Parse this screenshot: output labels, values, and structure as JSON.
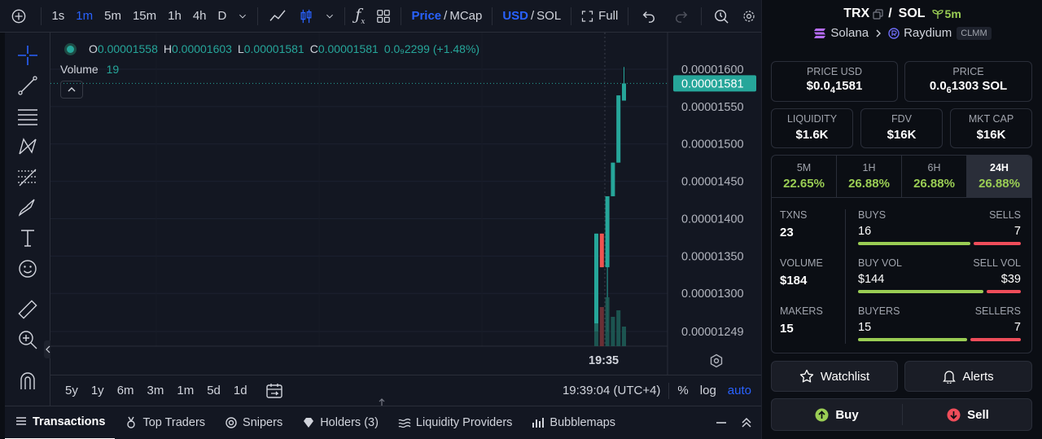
{
  "toolbar": {
    "intervals": [
      "1s",
      "1m",
      "5m",
      "15m",
      "1h",
      "4h",
      "D"
    ],
    "active_interval": "1m",
    "price_label": "Price",
    "mcap_label": "MCap",
    "usd_label": "USD",
    "sol_label": "SOL",
    "full_label": "Full",
    "accent": "#2962ff"
  },
  "legend": {
    "o_label": "O",
    "o_value": "0.00001558",
    "h_label": "H",
    "h_value": "0.00001603",
    "l_label": "L",
    "l_value": "0.00001581",
    "c_label": "C",
    "c_value": "0.00001581",
    "change": "0.0₉2299 (+1.48%)",
    "volume_label": "Volume",
    "volume_value": "19"
  },
  "chart_data": {
    "type": "candlestick",
    "y_ticks": [
      "0.00001600",
      "0.00001550",
      "0.00001500",
      "0.00001450",
      "0.00001400",
      "0.00001350",
      "0.00001300",
      "0.00001249"
    ],
    "ylim": [
      1.249e-05,
      1.6e-05
    ],
    "current_price": "0.00001581",
    "x_tick": "19:35",
    "candles": [
      {
        "o": 1.38e-05,
        "h": 1.38e-05,
        "l": 1.249e-05,
        "c": 1.249e-05,
        "dir": "up"
      },
      {
        "o": 1.335e-05,
        "h": 1.38e-05,
        "l": 1.335e-05,
        "c": 1.38e-05,
        "dir": "down"
      },
      {
        "o": 1.335e-05,
        "h": 1.43e-05,
        "l": 1.249e-05,
        "c": 1.43e-05,
        "dir": "up"
      },
      {
        "o": 1.43e-05,
        "h": 1.475e-05,
        "l": 1.43e-05,
        "c": 1.475e-05,
        "dir": "up"
      },
      {
        "o": 1.475e-05,
        "h": 1.565e-05,
        "l": 1.475e-05,
        "c": 1.565e-05,
        "dir": "up"
      },
      {
        "o": 1.558e-05,
        "h": 1.603e-05,
        "l": 1.558e-05,
        "c": 1.581e-05,
        "dir": "up"
      }
    ],
    "up_color": "#26a69a",
    "down_color": "#ef5350"
  },
  "timebar": {
    "ranges": [
      "5y",
      "1y",
      "6m",
      "3m",
      "1m",
      "5d",
      "1d"
    ],
    "clock": "19:39:04 (UTC+4)",
    "percent_label": "%",
    "log_label": "log",
    "auto_label": "auto"
  },
  "tabs": [
    {
      "label": "Transactions",
      "icon": "list-icon"
    },
    {
      "label": "Top Traders",
      "icon": "medal-icon"
    },
    {
      "label": "Snipers",
      "icon": "target-icon"
    },
    {
      "label": "Holders (3)",
      "icon": "diamond-icon"
    },
    {
      "label": "Liquidity Providers",
      "icon": "water-icon"
    },
    {
      "label": "Bubblemaps",
      "icon": "bubble-icon"
    }
  ],
  "token": {
    "symbol": "TRX",
    "quote": "SOL",
    "age": "5m",
    "chain": "Solana",
    "dex": "Raydium",
    "dex_tag": "CLMM"
  },
  "stats": {
    "price_usd_label": "PRICE USD",
    "price_usd_prefix": "$0.0",
    "price_usd_sub": "4",
    "price_usd_rest": "1581",
    "price_label": "PRICE",
    "price_prefix": "0.0",
    "price_sub": "6",
    "price_rest": "1303 SOL",
    "liquidity_label": "LIQUIDITY",
    "liquidity": "$1.6K",
    "fdv_label": "FDV",
    "fdv": "$16K",
    "mktcap_label": "MKT CAP",
    "mktcap": "$16K"
  },
  "timeframes": [
    {
      "label": "5M",
      "value": "22.65%"
    },
    {
      "label": "1H",
      "value": "26.88%"
    },
    {
      "label": "6H",
      "value": "26.88%"
    },
    {
      "label": "24H",
      "value": "26.88%"
    }
  ],
  "activity": {
    "txns_label": "TXNS",
    "txns": "23",
    "buys_label": "BUYS",
    "buys": "16",
    "sells_label": "SELLS",
    "sells": "7",
    "buys_fraction": 0.7,
    "volume_label": "VOLUME",
    "volume": "$184",
    "buy_vol_label": "BUY VOL",
    "buy_vol": "$144",
    "sell_vol_label": "SELL VOL",
    "sell_vol": "$39",
    "vol_fraction": 0.78,
    "makers_label": "MAKERS",
    "makers": "15",
    "buyers_label": "BUYERS",
    "buyers": "15",
    "sellers_label": "SELLERS",
    "sellers": "7",
    "buyers_fraction": 0.68
  },
  "actions": {
    "watchlist": "Watchlist",
    "alerts": "Alerts",
    "buy": "Buy",
    "sell": "Sell"
  }
}
